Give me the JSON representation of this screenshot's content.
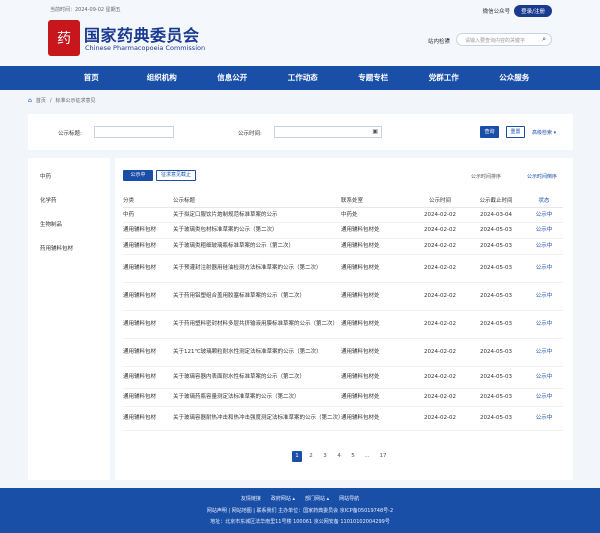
{
  "header": {
    "date": "当前时间：2024-09-02 星期五",
    "public_account": "微信公众号",
    "login": "登录/注册",
    "logo_seal": "药",
    "logo_cn": "国家药典委员会",
    "logo_en": "Chinese Pharmacopoeia Commission",
    "search_scope": "站内检索",
    "search_placeholder": "请输入要查询内容的关键字"
  },
  "nav": [
    "首页",
    "组织机构",
    "信息公开",
    "工作动态",
    "专题专栏",
    "党群工作",
    "公众服务"
  ],
  "breadcrumb": {
    "home": "首页",
    "current": "标准公示征求意见"
  },
  "search_panel": {
    "title_label": "公示标题:",
    "time_label": "公示时间:",
    "query": "查询",
    "reset": "重置",
    "advanced": "高级检索"
  },
  "sidebar": [
    "中药",
    "化学药",
    "生物制品",
    "药用辅料包材"
  ],
  "tabs": {
    "active": "公示中",
    "inactive": "征求意见截止"
  },
  "sort": {
    "by_time": "公示时间排序",
    "by_deadline": "公示时间倒序"
  },
  "table": {
    "headers": [
      "分类",
      "公示标题",
      "联系处室",
      "公示时间",
      "公示截止时间",
      "状态"
    ],
    "rows": [
      [
        "中药",
        "关于拟定口服饮片炮制规范标准草案的公示",
        "中药处",
        "2024-02-02",
        "2024-03-04",
        "公示中"
      ],
      [
        "通用辅料包材",
        "关于玻璃类包材标准草案的公示（第二次）",
        "通用辅料包材处",
        "2024-02-02",
        "2024-05-03",
        "公示中"
      ],
      [
        "通用辅料包材",
        "关于玻璃类粗细玻璃瓶标准草案的公示（第二次）",
        "通用辅料包材处",
        "2024-02-02",
        "2024-05-03",
        "公示中"
      ],
      [
        "通用辅料包材",
        "关于预灌封注射器用硅油检测方法标准草案的公示（第二次）",
        "通用辅料包材处",
        "2024-02-02",
        "2024-05-03",
        "公示中"
      ],
      [
        "通用辅料包材",
        "关于药用铝塑组合盖用胶塞标准草案的公示（第二次）",
        "通用辅料包材处",
        "2024-02-02",
        "2024-05-03",
        "公示中"
      ],
      [
        "通用辅料包材",
        "关于药用塑料密封材料多层共挤输液用膜标准草案的公示（第二次）",
        "通用辅料包材处",
        "2024-02-02",
        "2024-05-03",
        "公示中"
      ],
      [
        "通用辅料包材",
        "关于121℃玻璃颗粒耐水性测定法标准草案的公示（第二次）",
        "通用辅料包材处",
        "2024-02-02",
        "2024-05-03",
        "公示中"
      ],
      [
        "通用辅料包材",
        "关于玻璃容器内表面耐水性标准草案的公示（第二次）",
        "通用辅料包材处",
        "2024-02-02",
        "2024-05-03",
        "公示中"
      ],
      [
        "通用辅料包材",
        "关于玻璃药瓶容量测定法标准草案的公示（第二次）",
        "通用辅料包材处",
        "2024-02-02",
        "2024-05-03",
        "公示中"
      ],
      [
        "通用辅料包材",
        "关于玻璃容器耐热冲击和热冲击强度测定法标准草案的公示（第二次）",
        "通用辅料包材处",
        "2024-02-02",
        "2024-05-03",
        "公示中"
      ]
    ]
  },
  "pagination": [
    "1",
    "2",
    "3",
    "4",
    "5",
    "...",
    "17"
  ],
  "footer": {
    "links": [
      "友情链接",
      "政府网站 ▴",
      "部门网站 ▴",
      "网站导航"
    ],
    "line1": "网站声明 | 网站地图 | 联系我们  主办单位：国家药典委员会  京ICP备05019748号-2",
    "line2": "地址：北京市东城区法华南里11号楼 100061  京公网安备 11010102004299号"
  }
}
